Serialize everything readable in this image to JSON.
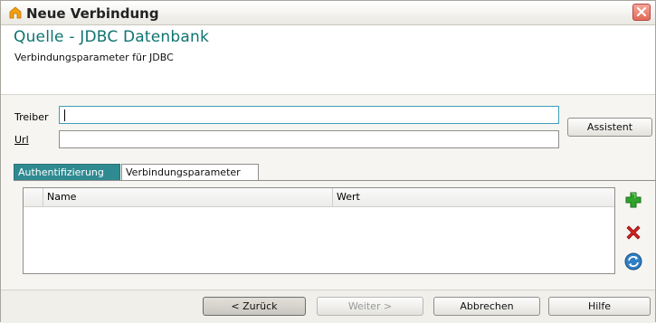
{
  "window": {
    "title": "Neue Verbindung"
  },
  "header": {
    "title": "Quelle - JDBC Datenbank",
    "subtitle": "Verbindungsparameter für JDBC"
  },
  "form": {
    "driver_label": "Treiber",
    "driver_value": "",
    "url_label": "Url",
    "url_value": "",
    "assistant_label": "Assistent"
  },
  "tabs": [
    {
      "label": "Authentifizierung",
      "active": false
    },
    {
      "label": "Verbindungsparameter",
      "active": true
    }
  ],
  "table": {
    "columns": [
      "Name",
      "Wert"
    ],
    "rows": []
  },
  "side_buttons": [
    "add-icon",
    "remove-icon",
    "refresh-icon"
  ],
  "footer": {
    "back_label": "< Zurück",
    "next_label": "Weiter >",
    "cancel_label": "Abbrechen",
    "help_label": "Hilfe"
  },
  "colors": {
    "accent": "#0e7470",
    "tab_inactive": "#2f8a91",
    "add_green": "#2ea42a",
    "remove_red": "#d32222",
    "refresh_blue": "#2f7fc4"
  }
}
